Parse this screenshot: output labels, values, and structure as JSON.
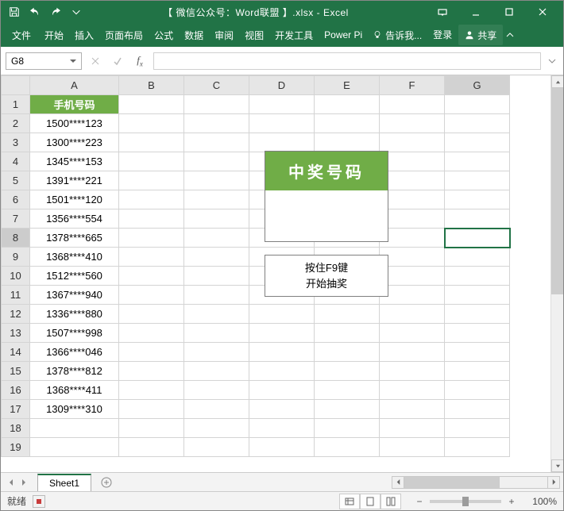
{
  "titlebar": {
    "title": "【 微信公众号：Word联盟 】.xlsx - Excel"
  },
  "ribbon": {
    "file": "文件",
    "tabs": [
      "开始",
      "插入",
      "页面布局",
      "公式",
      "数据",
      "审阅",
      "视图",
      "开发工具",
      "Power Pi"
    ],
    "tellme": "告诉我...",
    "signin": "登录",
    "share": "共享"
  },
  "namebox": {
    "value": "G8"
  },
  "grid": {
    "columns": [
      "A",
      "B",
      "C",
      "D",
      "E",
      "F",
      "G"
    ],
    "rows": [
      "1",
      "2",
      "3",
      "4",
      "5",
      "6",
      "7",
      "8",
      "9",
      "10",
      "11",
      "12",
      "13",
      "14",
      "15",
      "16",
      "17",
      "18",
      "19"
    ],
    "headerA": "手机号码",
    "colA": [
      "1500****123",
      "1300****223",
      "1345****153",
      "1391****221",
      "1501****120",
      "1356****554",
      "1378****665",
      "1368****410",
      "1512****560",
      "1367****940",
      "1336****880",
      "1507****998",
      "1366****046",
      "1378****812",
      "1368****411",
      "1309****310"
    ],
    "active": "G8"
  },
  "prize": {
    "header": "中奖号码",
    "instr1": "按住F9键",
    "instr2": "开始抽奖"
  },
  "sheets": {
    "active": "Sheet1"
  },
  "status": {
    "ready": "就绪",
    "zoom": "100%"
  }
}
